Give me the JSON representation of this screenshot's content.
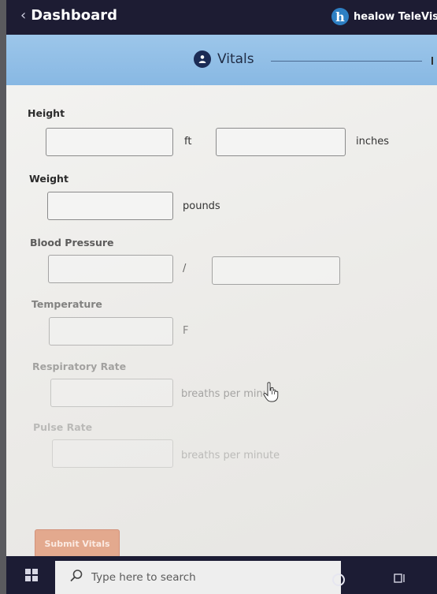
{
  "header": {
    "back_label": "Dashboard",
    "brand_name": "healow TeleVisi",
    "brand_logo_letter": "h"
  },
  "subheader": {
    "title": "Vitals",
    "icon": "person-vitals-icon"
  },
  "form": {
    "height": {
      "label": "Height",
      "unit_ft": "ft",
      "unit_in": "inches"
    },
    "weight": {
      "label": "Weight",
      "unit": "pounds"
    },
    "blood_pressure": {
      "label": "Blood Pressure",
      "separator": "/"
    },
    "temperature": {
      "label": "Temperature",
      "unit": "F"
    },
    "respiratory_rate": {
      "label": "Respiratory Rate",
      "unit": "breaths per minu"
    },
    "pulse_rate": {
      "label": "Pulse Rate",
      "unit": "breaths per minute"
    },
    "submit_label": "Submit Vitals"
  },
  "taskbar": {
    "search_placeholder": "Type here to search"
  },
  "colors": {
    "header_bg": "#1d1c33",
    "subheader_bg": "#88b8e3",
    "submit_bg": "#e3a98e",
    "taskbar_bg": "#1c1c34"
  }
}
